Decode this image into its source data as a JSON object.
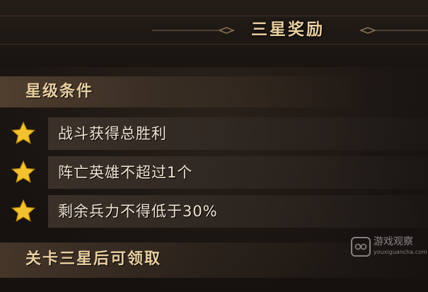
{
  "header": {
    "title": "三星奖励"
  },
  "conditions": {
    "heading": "星级条件",
    "items": [
      {
        "label": "战斗获得总胜利"
      },
      {
        "label": "阵亡英雄不超过1个"
      },
      {
        "label": "剩余兵力不得低于30%"
      }
    ]
  },
  "footer": {
    "text": "关卡三星后可领取"
  },
  "watermark": {
    "name": "游戏观察",
    "url": "youxiguancha.com"
  },
  "colors": {
    "star": "#f2c230",
    "title": "#e9cfa0",
    "text": "#efe4d2"
  }
}
